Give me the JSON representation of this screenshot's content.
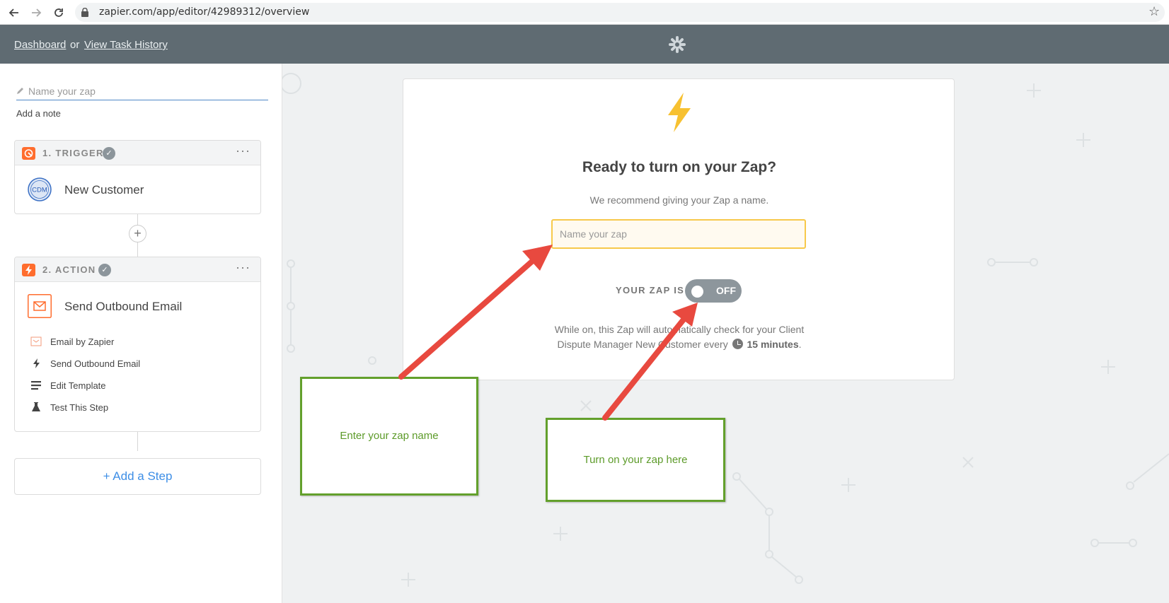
{
  "browser": {
    "url": "zapier.com/app/editor/42989312/overview"
  },
  "header": {
    "dashboard_link": "Dashboard",
    "or_text": "or",
    "task_history_link": "View Task History"
  },
  "sidebar": {
    "name_placeholder": "Name your zap",
    "add_note": "Add a note",
    "trigger": {
      "title": "1. TRIGGER",
      "app_badge": "CDM",
      "app_name": "New Customer"
    },
    "action": {
      "title": "2. ACTION",
      "app_name": "Send Outbound Email",
      "items": [
        {
          "label": "Email by Zapier"
        },
        {
          "label": "Send Outbound Email"
        },
        {
          "label": "Edit Template"
        },
        {
          "label": "Test This Step"
        }
      ]
    },
    "add_step": "+ Add a Step"
  },
  "main_card": {
    "title": "Ready to turn on your Zap?",
    "subtitle": "We recommend giving your Zap a name.",
    "input_placeholder": "Name your zap",
    "status_label": "YOUR ZAP IS",
    "toggle_state": "OFF",
    "note_line1": "While on, this Zap will automatically check for your Client",
    "note_line2_prefix": "Dispute Manager New Customer every",
    "note_interval": "15 minutes",
    "note_suffix": "."
  },
  "annotations": {
    "callout_name": "Enter your zap name",
    "callout_toggle": "Turn on your zap here",
    "arrow_color": "#e8493f",
    "callout_border_color": "#63a02c"
  },
  "colors": {
    "header_bg": "#5f6b72",
    "accent_blue": "#3d8ee6",
    "zapier_orange": "#ff6d2e",
    "bolt_yellow": "#f7c131"
  }
}
